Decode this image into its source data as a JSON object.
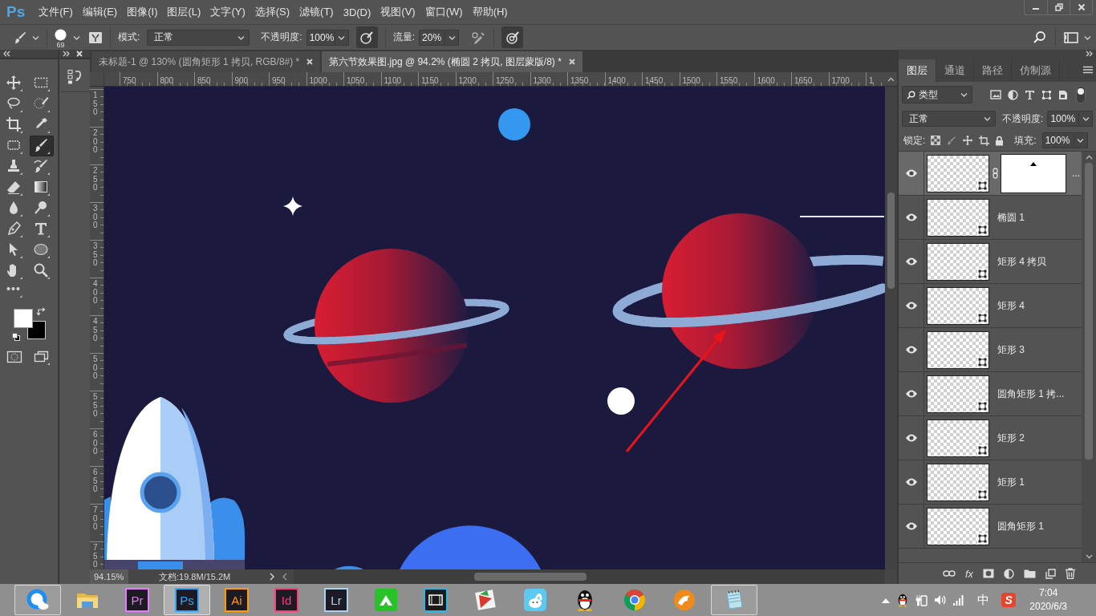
{
  "app": {
    "logo": "Ps"
  },
  "menu_bar": {
    "items": [
      "文件(F)",
      "编辑(E)",
      "图像(I)",
      "图层(L)",
      "文字(Y)",
      "选择(S)",
      "滤镜(T)",
      "3D(D)",
      "视图(V)",
      "窗口(W)",
      "帮助(H)"
    ]
  },
  "options_bar": {
    "brush_size": "69",
    "mode_label": "模式:",
    "mode": "正常",
    "opacity_label": "不透明度:",
    "opacity": "100%",
    "flow_label": "流量:",
    "flow": "20%"
  },
  "tools": [
    {
      "kind": "move",
      "selected": false
    },
    {
      "kind": "marquee",
      "selected": false
    },
    {
      "kind": "lasso",
      "selected": false
    },
    {
      "kind": "quickselect",
      "selected": false
    },
    {
      "kind": "crop",
      "selected": false
    },
    {
      "kind": "eyedropper",
      "selected": false
    },
    {
      "kind": "patch",
      "selected": false
    },
    {
      "kind": "brush",
      "selected": true
    },
    {
      "kind": "stamp",
      "selected": false
    },
    {
      "kind": "historybrush",
      "selected": false
    },
    {
      "kind": "eraser",
      "selected": false
    },
    {
      "kind": "gradient",
      "selected": false
    },
    {
      "kind": "blur",
      "selected": false
    },
    {
      "kind": "dodge",
      "selected": false
    },
    {
      "kind": "pen",
      "selected": false
    },
    {
      "kind": "type",
      "selected": false
    },
    {
      "kind": "pathselect",
      "selected": false
    },
    {
      "kind": "ellipse",
      "selected": false
    },
    {
      "kind": "hand",
      "selected": false
    },
    {
      "kind": "zoom",
      "selected": false
    },
    {
      "kind": "more",
      "selected": false
    }
  ],
  "document_tabs": [
    {
      "title": "未标题-1 @ 130% (圆角矩形 1 拷贝, RGB/8#) *",
      "selected": false
    },
    {
      "title": "第六节效果图.jpg @ 94.2% (椭圆 2 拷贝, 图层蒙版/8) *",
      "selected": true
    }
  ],
  "rulers": {
    "horizontal": [
      "750",
      "800",
      "850",
      "900",
      "950",
      "1000",
      "1050",
      "1100",
      "1150",
      "1200",
      "1250",
      "1300",
      "1350",
      "1400",
      "1450",
      "1500",
      "1550",
      "1600",
      "1650",
      "1700",
      "1"
    ],
    "vertical": [
      "150",
      "200",
      "250",
      "300",
      "350",
      "400",
      "450",
      "500",
      "550",
      "600",
      "650",
      "700",
      "750"
    ]
  },
  "status_bar": {
    "zoom": "94.15%",
    "document": "文档:19.8M/15.2M"
  },
  "layers_panel": {
    "tabs": [
      {
        "label": "图层",
        "selected": true
      },
      {
        "label": "通道",
        "selected": false
      },
      {
        "label": "路径",
        "selected": false
      },
      {
        "label": "仿制源",
        "selected": false
      }
    ],
    "filter": "类型",
    "blend_mode": "正常",
    "opacity_label": "不透明度:",
    "opacity": "100%",
    "lock_label": "锁定:",
    "fill_label": "填充:",
    "fill": "100%",
    "style_button": "fx",
    "layers": [
      {
        "name": "...",
        "visible": true,
        "selected": true,
        "has_mask": true
      },
      {
        "name": "椭圆 1",
        "visible": true,
        "selected": false,
        "has_mask": false
      },
      {
        "name": "矩形 4 拷贝",
        "visible": true,
        "selected": false,
        "has_mask": false
      },
      {
        "name": "矩形 4",
        "visible": true,
        "selected": false,
        "has_mask": false
      },
      {
        "name": "矩形 3",
        "visible": true,
        "selected": false,
        "has_mask": false
      },
      {
        "name": "圆角矩形 1 拷...",
        "visible": true,
        "selected": false,
        "has_mask": false
      },
      {
        "name": "矩形 2",
        "visible": true,
        "selected": false,
        "has_mask": false
      },
      {
        "name": "矩形 1",
        "visible": true,
        "selected": false,
        "has_mask": false
      },
      {
        "name": "圆角矩形 1",
        "visible": true,
        "selected": false,
        "has_mask": false
      }
    ]
  },
  "taskbar": {
    "apps": [
      {
        "kind": "browser",
        "open": true,
        "selected": false
      },
      {
        "kind": "folder",
        "open": false,
        "selected": false
      },
      {
        "kind": "adobe",
        "label": "Pr",
        "color": "#e57bff",
        "open": false,
        "selected": false
      },
      {
        "kind": "adobe",
        "label": "Ps",
        "color": "#31a8ff",
        "open": true,
        "selected": true
      },
      {
        "kind": "adobe",
        "label": "Ai",
        "color": "#ff9a00",
        "open": false,
        "selected": false
      },
      {
        "kind": "adobe",
        "label": "Id",
        "color": "#ff3d7a",
        "open": false,
        "selected": false
      },
      {
        "kind": "adobe",
        "label": "Lr",
        "color": "#a9d2ee",
        "open": false,
        "selected": false
      },
      {
        "kind": "green",
        "open": false,
        "selected": false
      },
      {
        "kind": "film",
        "open": false,
        "selected": false
      },
      {
        "kind": "shield",
        "open": false,
        "selected": false
      },
      {
        "kind": "bunny",
        "open": false,
        "selected": false
      },
      {
        "kind": "penguin",
        "open": false,
        "selected": false
      },
      {
        "kind": "chrome",
        "open": false,
        "selected": false
      },
      {
        "kind": "cheetah",
        "open": false,
        "selected": false
      },
      {
        "kind": "notepad",
        "open": true,
        "selected": false
      }
    ],
    "tray": {
      "ime": "中",
      "ime_logo": "S",
      "time": "7:04",
      "date": "2020/6/3"
    }
  }
}
